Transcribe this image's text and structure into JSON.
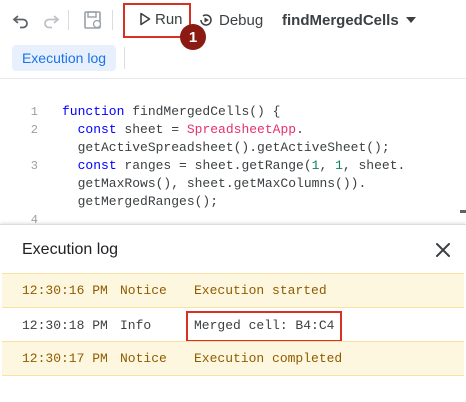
{
  "toolbar": {
    "undo_icon": "undo-icon",
    "redo_icon": "redo-icon",
    "save_icon": "save-to-drive-icon",
    "run_label": "Run",
    "debug_label": "Debug",
    "function_selected": "findMergedCells",
    "annotation_number": "1"
  },
  "tabs": {
    "execution_log": "Execution log"
  },
  "editor": {
    "line_numbers": [
      "1",
      "2",
      "3",
      "4"
    ],
    "lines": [
      "function findMergedCells() {",
      "  const sheet = SpreadsheetApp.",
      "  getActiveSpreadsheet().getActiveSheet();",
      "  const ranges = sheet.getRange(1, 1, sheet.",
      "  getMaxRows(), sheet.getMaxColumns()).",
      "  getMergedRanges();"
    ]
  },
  "log": {
    "title": "Execution log",
    "rows": [
      {
        "time": "12:30:16 PM",
        "level": "Notice",
        "message": "Execution started"
      },
      {
        "time": "12:30:18 PM",
        "level": "Info",
        "message": "Merged cell: B4:C4"
      },
      {
        "time": "12:30:17 PM",
        "level": "Notice",
        "message": "Execution completed"
      }
    ]
  },
  "colors": {
    "highlight": "#d93025",
    "badge": "#8b1a12",
    "accent": "#1a73e8",
    "notice_bg": "#fef7e0"
  }
}
